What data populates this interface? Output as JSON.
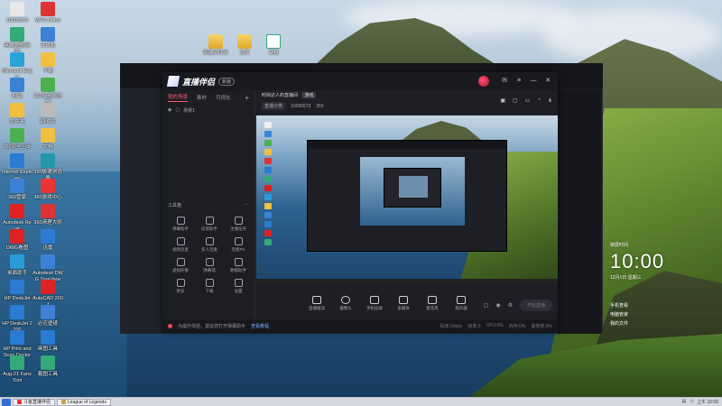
{
  "desktop": {
    "icons": [
      {
        "label": "10090573",
        "color": "#e8e8e8"
      },
      {
        "label": "WPS Office",
        "color": "#d33"
      },
      {
        "label": "英雄联盟(新手)",
        "color": "#3a7"
      },
      {
        "label": "计算机",
        "color": "#3b82d6"
      },
      {
        "label": "Microsoft Edge",
        "color": "#2aa3d8"
      },
      {
        "label": "下载",
        "color": "#f0c040"
      },
      {
        "label": "网络",
        "color": "#3b82d6"
      },
      {
        "label": "360安全浏览器",
        "color": "#4caf50"
      },
      {
        "label": "文件夹",
        "color": "#f0c040"
      },
      {
        "label": "回收站",
        "color": "#bbb"
      },
      {
        "label": "360安全卫士",
        "color": "#4caf50"
      },
      {
        "label": "文档",
        "color": "#f0c040"
      },
      {
        "label": "Internet Explorer",
        "color": "#2a7bd1"
      },
      {
        "label": "360极速浏览器",
        "color": "#29a"
      },
      {
        "label": "360管家",
        "color": "#3b82d6"
      },
      {
        "label": "360游戏中心",
        "color": "#e33"
      },
      {
        "label": "Autodesk Revit",
        "color": "#d22"
      },
      {
        "label": "360清理大师",
        "color": "#d33"
      },
      {
        "label": "DWG看图",
        "color": "#d22"
      },
      {
        "label": "迅雷",
        "color": "#2a7bd1"
      },
      {
        "label": "桌面助手",
        "color": "#2a9bd6"
      },
      {
        "label": "Autodesk DWG TrueView",
        "color": "#3b82d6"
      },
      {
        "label": "HP DeskJet",
        "color": "#2a7bd1"
      },
      {
        "label": "AutoCAD 2007",
        "color": "#d22"
      },
      {
        "label": "HP DeskJet 2700",
        "color": "#2a7bd1"
      },
      {
        "label": "必应壁纸",
        "color": "#3b82d6"
      },
      {
        "label": "HP Print and Scan Doctor",
        "color": "#2a7bd1"
      },
      {
        "label": "画图工具",
        "color": "#2a7bd1"
      },
      {
        "label": "Aug-21 Fans Tool",
        "color": "#3a7"
      },
      {
        "label": "截图工具",
        "color": "#3a7"
      }
    ],
    "folders": [
      "新建文件夹",
      "文件",
      "文档"
    ]
  },
  "app": {
    "name": "直播伴侣",
    "version_tag": "新版",
    "left_tabs": [
      "我的场景",
      "素材",
      "可视化"
    ],
    "add_glyph": "+",
    "scene_label": "场景1",
    "tools_title": "工具箱",
    "tools": [
      {
        "label": "弹幕助手",
        "icon": "chat-icon"
      },
      {
        "label": "房管助手",
        "icon": "user-icon"
      },
      {
        "label": "主播任务",
        "icon": "task-icon"
      },
      {
        "label": "视频连麦",
        "icon": "video-icon"
      },
      {
        "label": "多人连麦",
        "icon": "download-icon"
      },
      {
        "label": "连麦PK",
        "icon": "pk-icon"
      },
      {
        "label": "虚拟形象",
        "icon": "avatar-icon"
      },
      {
        "label": "弹幕墙",
        "icon": "wall-icon"
      },
      {
        "label": "数据助手",
        "icon": "data-icon"
      },
      {
        "label": "更多",
        "icon": "more-icon"
      },
      {
        "label": "下载",
        "icon": "download-icon"
      },
      {
        "label": "设置",
        "icon": "settings-icon"
      }
    ],
    "header": {
      "title": "时尚达人的直播间",
      "badge": "游戏",
      "category": "直播分类",
      "account": "10090573",
      "fans": "355"
    },
    "controls": [
      {
        "label": "直播推流",
        "icon": "stream-icon"
      },
      {
        "label": "摄像头",
        "icon": "camera-icon"
      },
      {
        "label": "手机投屏",
        "icon": "phone-icon"
      },
      {
        "label": "多媒体",
        "icon": "media-icon"
      },
      {
        "label": "麦克风",
        "icon": "mic-icon"
      },
      {
        "label": "扬声器",
        "icon": "speaker-icon"
      }
    ],
    "start_live_label": "开始直播",
    "status": {
      "message": "为提升体验，建议您打开弹幕助手",
      "link": "查看教程",
      "stats": [
        "码率:0kbps",
        "帧率:0",
        "CPU:0%",
        "内存:0%",
        "丢帧率:0%"
      ]
    }
  },
  "clock": {
    "time": "10:00",
    "date": "12月1日 星期三",
    "top_label": "锁屏时间",
    "widgets": [
      "手机查看",
      "电脑管家",
      "我的文件"
    ]
  },
  "taskbar": {
    "items": [
      {
        "label": "斗鱼直播伴侣",
        "color": "#e33"
      },
      {
        "label": "League of Legends",
        "color": "#c8a24a"
      }
    ],
    "tray": "上午 10:00"
  }
}
